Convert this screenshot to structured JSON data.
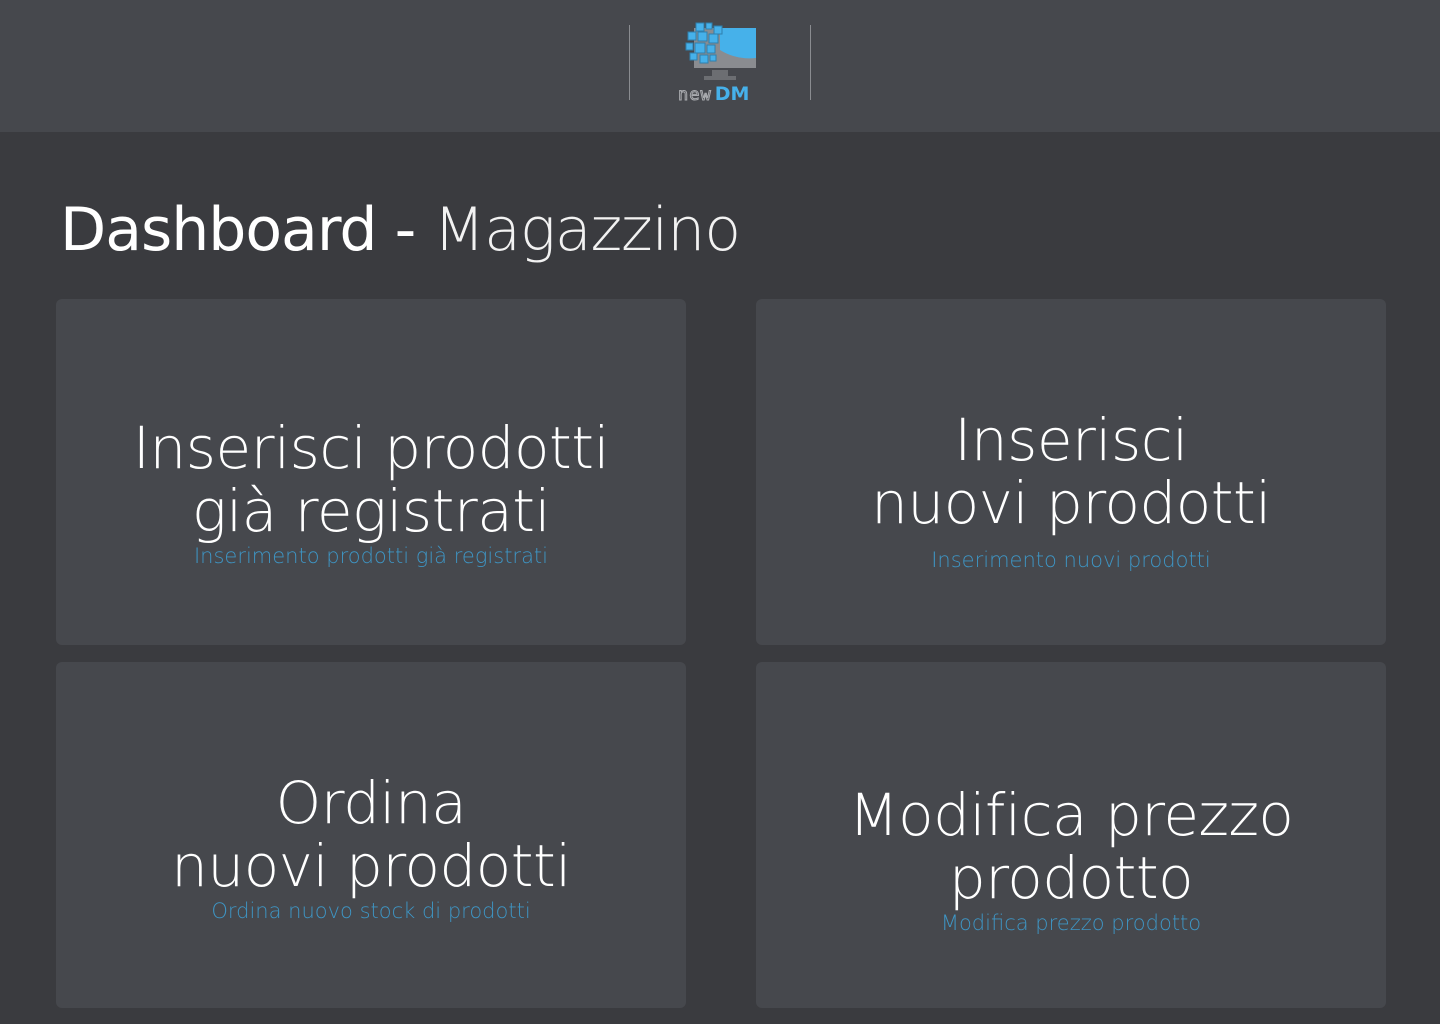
{
  "header": {
    "logo": {
      "text_new": "new",
      "text_dm": "DM",
      "accent_color": "#46b1ea",
      "icon": "monitor-pixels-icon"
    }
  },
  "page_title": {
    "main": "Dashboard",
    "separator": "-",
    "sub": "Magazzino"
  },
  "cards": [
    {
      "title_lines": [
        "Inserisci prodotti",
        "già registrati"
      ],
      "description": "Inserimento prodotti  già registrati"
    },
    {
      "title_lines": [
        "Inserisci",
        "nuovi prodotti"
      ],
      "description": "Inserimento nuovi prodotti"
    },
    {
      "title_lines": [
        "Ordina",
        "nuovi prodotti"
      ],
      "description": "Ordina nuovo stock di prodotti"
    },
    {
      "title_lines": [
        "Modifica prezzo",
        "prodotto"
      ],
      "description": "Modifica  prezzo prodotto"
    }
  ],
  "colors": {
    "background": "#3a3b3f",
    "card": "#46484d",
    "header": "#46484d",
    "description": "#3e95c4"
  }
}
